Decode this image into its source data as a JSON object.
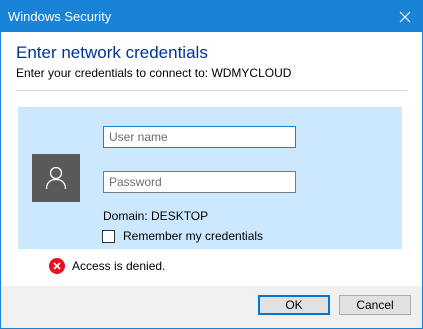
{
  "window": {
    "title": "Windows Security"
  },
  "dialog": {
    "heading": "Enter network credentials",
    "subheading": "Enter your credentials to connect to: WDMYCLOUD"
  },
  "credentials": {
    "username_placeholder": "User name",
    "username_value": "",
    "password_placeholder": "Password",
    "password_value": "",
    "domain_text": "Domain: DESKTOP",
    "remember_label": "Remember my credentials",
    "remember_checked": false,
    "avatar_icon": "user-icon"
  },
  "status": {
    "error_icon": "error-icon",
    "error_text": "Access is denied."
  },
  "buttons": {
    "ok_label": "OK",
    "cancel_label": "Cancel"
  },
  "colors": {
    "titlebar": "#1883d7",
    "panel": "#cce8ff",
    "heading": "#003399",
    "error": "#e81123",
    "avatar": "#595959"
  }
}
